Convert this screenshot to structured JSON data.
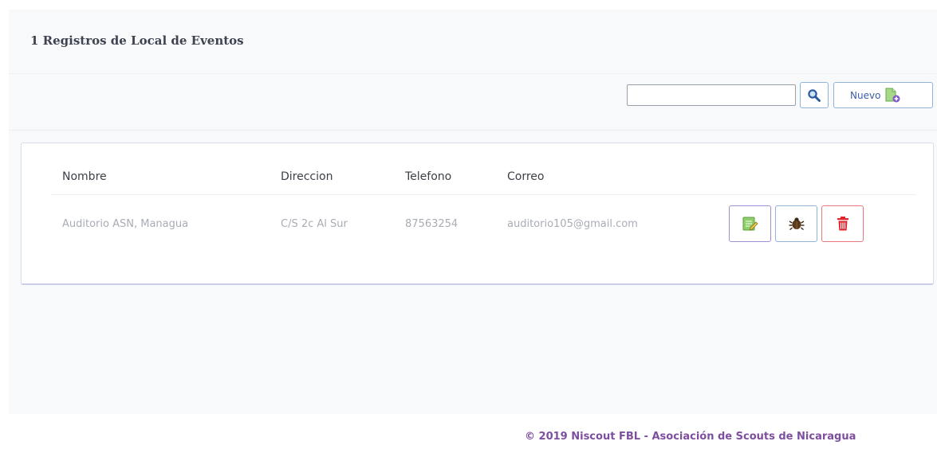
{
  "header": {
    "title": "1 Registros de Local de Eventos"
  },
  "toolbar": {
    "search_value": "",
    "search_placeholder": "",
    "new_label": "Nuevo"
  },
  "table": {
    "columns": [
      "Nombre",
      "Direccion",
      "Telefono",
      "Correo"
    ],
    "rows": [
      {
        "nombre": "Auditorio ASN, Managua",
        "direccion": "C/S 2c Al Sur",
        "telefono": "87563254",
        "correo": "auditorio105@gmail.com"
      }
    ]
  },
  "icons": {
    "search": "magnifier-icon",
    "new": "add-document-icon",
    "edit": "edit-note-icon",
    "view": "bug-view-icon",
    "delete": "trash-icon"
  },
  "colors": {
    "edit_border": "#9b8fd6",
    "view_border": "#8fb3d9",
    "delete_border": "#e7787e",
    "delete_icon": "#e0242c",
    "footer_text": "#7d4f9e"
  },
  "footer": {
    "text": "© 2019 Niscout FBL - Asociación de Scouts de Nicaragua"
  }
}
